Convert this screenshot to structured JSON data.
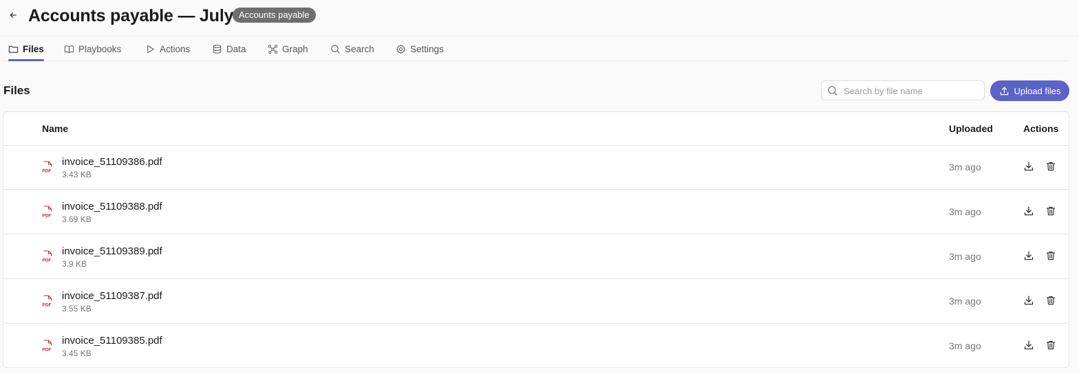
{
  "header": {
    "title": "Accounts payable — July",
    "badge": "Accounts payable",
    "back_icon": "arrow-left-icon"
  },
  "tabs": [
    {
      "label": "Files",
      "icon": "folder-icon",
      "active": true
    },
    {
      "label": "Playbooks",
      "icon": "book-icon",
      "active": false
    },
    {
      "label": "Actions",
      "icon": "play-icon",
      "active": false
    },
    {
      "label": "Data",
      "icon": "database-icon",
      "active": false
    },
    {
      "label": "Graph",
      "icon": "graph-icon",
      "active": false
    },
    {
      "label": "Search",
      "icon": "search-icon",
      "active": false
    },
    {
      "label": "Settings",
      "icon": "gear-icon",
      "active": false
    }
  ],
  "files_section": {
    "title": "Files",
    "search_placeholder": "Search by file name",
    "search_value": "",
    "upload_label": "Upload files"
  },
  "table": {
    "columns": [
      "Name",
      "Uploaded",
      "Actions"
    ],
    "rows": [
      {
        "name": "invoice_51109386.pdf",
        "size": "3.43 KB",
        "uploaded": "3m ago"
      },
      {
        "name": "invoice_51109388.pdf",
        "size": "3.69 KB",
        "uploaded": "3m ago"
      },
      {
        "name": "invoice_51109389.pdf",
        "size": "3.9 KB",
        "uploaded": "3m ago"
      },
      {
        "name": "invoice_51109387.pdf",
        "size": "3.55 KB",
        "uploaded": "3m ago"
      },
      {
        "name": "invoice_51109385.pdf",
        "size": "3.45 KB",
        "uploaded": "3m ago"
      }
    ]
  },
  "colors": {
    "accent": "#5b63c6",
    "badge_bg": "#6e6e6e",
    "pdf_red": "#c62828"
  }
}
